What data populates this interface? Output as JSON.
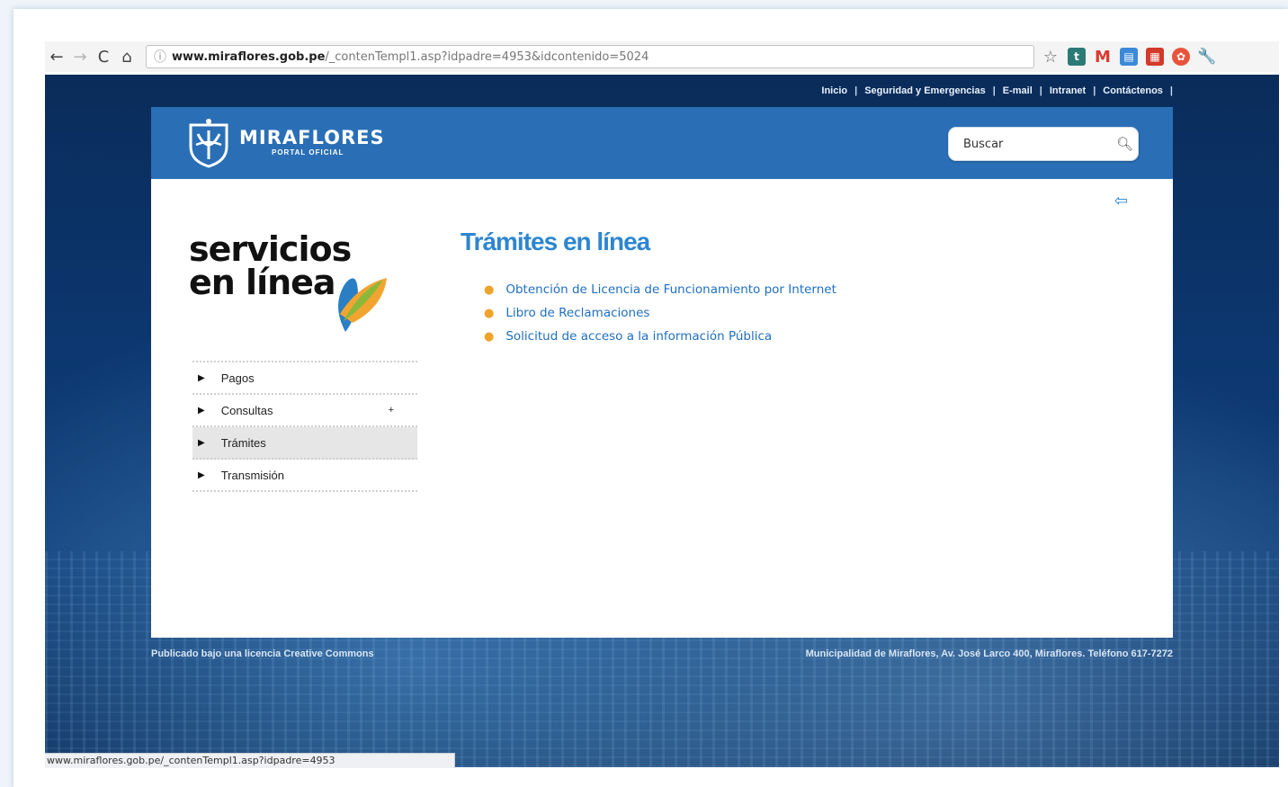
{
  "browser": {
    "nav": {
      "back": "←",
      "forward": "→",
      "reload": "C",
      "home": "⌂"
    },
    "url": {
      "scheme_icon": "ⓘ",
      "host": "www.miraflores.gob.pe",
      "path": "/_contenTempl1.asp?idpadre=4953&idcontenido=5024"
    },
    "extensions": [
      "star-icon",
      "teal-extension-icon",
      "gmail-icon",
      "docs-icon",
      "calendar-icon",
      "red-extension-icon",
      "wrench-icon"
    ],
    "status_url": "www.miraflores.gob.pe/_contenTempl1.asp?idpadre=4953"
  },
  "site": {
    "topnav": [
      "Inicio",
      "Seguridad y Emergencias",
      "E-mail",
      "Intranet",
      "Contáctenos"
    ],
    "logo": {
      "name": "MIRAFLORES",
      "subtitle": "PORTAL OFICIAL"
    },
    "search": {
      "placeholder": "Buscar"
    },
    "brand": {
      "line1": "servicios",
      "line2": "en línea"
    },
    "side_menu": [
      {
        "label": "Pagos",
        "active": false,
        "has_plus": false
      },
      {
        "label": "Consultas",
        "active": false,
        "has_plus": true,
        "plus": "+"
      },
      {
        "label": "Trámites",
        "active": true,
        "has_plus": false
      },
      {
        "label": "Transmisión",
        "active": false,
        "has_plus": false
      }
    ],
    "main": {
      "title": "Trámites en línea",
      "links": [
        "Obtención de Licencia de Funcionamiento por Internet",
        "Libro de Reclamaciones",
        "Solicitud de acceso a la información Pública"
      ]
    },
    "footer": {
      "left": "Publicado bajo una licencia Creative Commons",
      "right": "Municipalidad de Miraflores, Av. José Larco 400, Miraflores. Teléfono 617-7272"
    },
    "colors": {
      "banner": "#2a6fb6",
      "title_blue": "#2d86d0",
      "link_blue": "#1f6fbe",
      "bullet_orange": "#f0a22a"
    }
  }
}
